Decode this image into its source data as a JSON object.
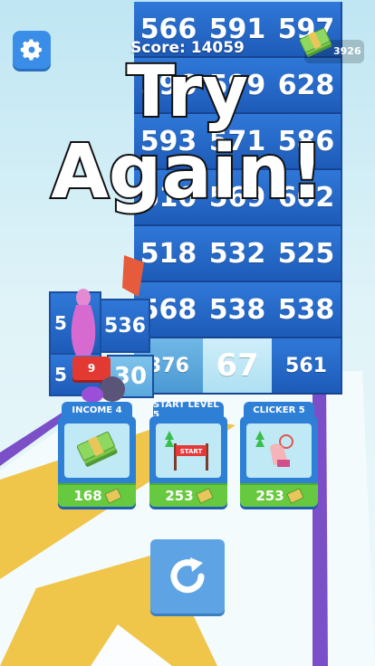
{
  "hud": {
    "score_text": "Score: 14059",
    "money": "3926"
  },
  "title": {
    "line1": "Try",
    "line2": "Again!"
  },
  "wall": {
    "rows": [
      [
        "566",
        "591",
        "597"
      ],
      [
        "596",
        "599",
        "628"
      ],
      [
        "593",
        "571",
        "586"
      ],
      [
        "610",
        "569",
        "602"
      ],
      [
        "518",
        "532",
        "525"
      ],
      [
        "568",
        "538",
        "538"
      ],
      [
        "376",
        "67",
        "561"
      ]
    ]
  },
  "side_blocks": [
    "536",
    "5",
    "5",
    "30"
  ],
  "upgrades": [
    {
      "name": "INCOME 4",
      "price": "168",
      "icon": "cash-stack-icon"
    },
    {
      "name": "START LEVEL 5",
      "price": "253",
      "icon": "start-banner-icon",
      "banner": "START"
    },
    {
      "name": "CLICKER 5",
      "price": "253",
      "icon": "hand-clicker-icon"
    }
  ],
  "pin_number": "9",
  "colors": {
    "block": "#2f78d8",
    "card": "#2e7fd6",
    "price": "#67c93f",
    "retry": "#5ea4e4"
  }
}
